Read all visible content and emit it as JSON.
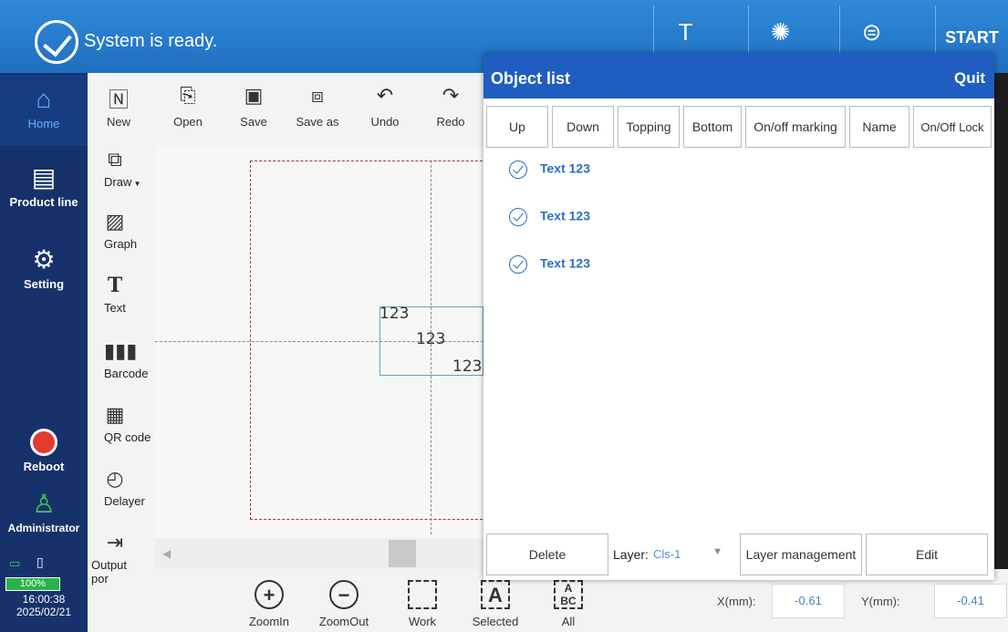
{
  "status": {
    "text": "System is ready."
  },
  "topbar": {
    "start_label": "START"
  },
  "sidebar": {
    "items": [
      {
        "label": "Home"
      },
      {
        "label": "Product line"
      },
      {
        "label": "Setting"
      },
      {
        "label": "Reboot"
      },
      {
        "label": "Administrator"
      }
    ],
    "battery": "100%",
    "time": "16:00:38",
    "date": "2025/02/21"
  },
  "toolbar": {
    "items": [
      {
        "label": "New"
      },
      {
        "label": "Open"
      },
      {
        "label": "Save"
      },
      {
        "label": "Save as"
      },
      {
        "label": "Undo"
      },
      {
        "label": "Redo"
      }
    ]
  },
  "tools": {
    "items": [
      {
        "label": "Draw"
      },
      {
        "label": "Graph"
      },
      {
        "label": "Text"
      },
      {
        "label": "Barcode"
      },
      {
        "label": "QR code"
      },
      {
        "label": "Delayer"
      },
      {
        "label": "Output por"
      }
    ]
  },
  "canvas": {
    "texts": [
      "123",
      "123",
      "123"
    ]
  },
  "bottom": {
    "items": [
      {
        "label": "ZoomIn"
      },
      {
        "label": "ZoomOut"
      },
      {
        "label": "Work"
      },
      {
        "label": "Selected"
      },
      {
        "label": "All"
      }
    ],
    "x_label": "X(mm):",
    "x_value": "-0.61",
    "y_label": "Y(mm):",
    "y_value": "-0.41"
  },
  "panel": {
    "title": "Object list",
    "quit": "Quit",
    "buttons": [
      "Up",
      "Down",
      "Topping",
      "Bottom",
      "On/off marking",
      "Name",
      "On/Off Lock"
    ],
    "objects": [
      "Text 123",
      "Text 123",
      "Text 123"
    ],
    "delete": "Delete",
    "layer_label": "Layer:",
    "layer_value": "Cls-1",
    "layer_management": "Layer management",
    "edit": "Edit"
  },
  "colors": {
    "header_blue": "#1f6fc0",
    "sidebar_navy": "#17326b",
    "panel_blue": "#1f5ec0",
    "accent": "#2b6cc4"
  }
}
